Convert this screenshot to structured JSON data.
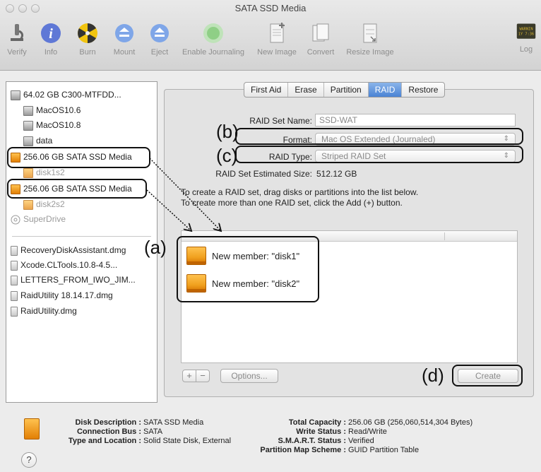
{
  "window": {
    "title": "SATA SSD Media"
  },
  "toolbar": {
    "items": [
      {
        "label": "Verify",
        "icon": "microscope-icon"
      },
      {
        "label": "Info",
        "icon": "info-icon"
      },
      {
        "label": "Burn",
        "icon": "burn-icon"
      },
      {
        "label": "Mount",
        "icon": "mount-icon"
      },
      {
        "label": "Eject",
        "icon": "eject-icon"
      },
      {
        "label": "Enable Journaling",
        "icon": "journal-icon"
      },
      {
        "label": "New Image",
        "icon": "new-image-icon"
      },
      {
        "label": "Convert",
        "icon": "convert-icon"
      },
      {
        "label": "Resize Image",
        "icon": "resize-image-icon"
      },
      {
        "label": "Log",
        "icon": "log-icon"
      }
    ],
    "log_icon_text": "WARNIN\n1Y 7:36"
  },
  "sidebar": {
    "items": [
      {
        "label": "64.02 GB C300-MTFDD...",
        "type": "disk-grey"
      },
      {
        "label": "MacOS10.6",
        "type": "disk-grey"
      },
      {
        "label": "MacOS10.8",
        "type": "disk-grey"
      },
      {
        "label": "data",
        "type": "disk-grey"
      },
      {
        "label": "256.06 GB SATA SSD Media",
        "type": "disk-orange"
      },
      {
        "label": "disk1s2",
        "type": "disk-orange"
      },
      {
        "label": "256.06 GB SATA SSD Media",
        "type": "disk-orange"
      },
      {
        "label": "disk2s2",
        "type": "disk-orange"
      },
      {
        "label": "SuperDrive",
        "type": "optical"
      },
      {
        "label": "RecoveryDiskAssistant.dmg",
        "type": "dmg"
      },
      {
        "label": "Xcode.CLTools.10.8-4.5...",
        "type": "dmg"
      },
      {
        "label": "LETTERS_FROM_IWO_JIM...",
        "type": "dmg"
      },
      {
        "label": "RaidUtility 18.14.17.dmg",
        "type": "dmg"
      },
      {
        "label": "RaidUtility.dmg",
        "type": "dmg"
      }
    ]
  },
  "tabs": [
    "First Aid",
    "Erase",
    "Partition",
    "RAID",
    "Restore"
  ],
  "active_tab": "RAID",
  "raid": {
    "set_name_label": "RAID Set Name:",
    "set_name_value": "SSD-WAT",
    "format_label": "Format:",
    "format_value": "Mac OS Extended (Journaled)",
    "type_label": "RAID Type:",
    "type_value": "Striped RAID Set",
    "size_label": "RAID Set Estimated Size:",
    "size_value": "512.12 GB",
    "info_line1": "To create a RAID set, drag disks or partitions into the list below.",
    "info_line2": "To create more than one RAID set, click the Add (+) button.",
    "members": [
      "New member: \"disk1\"",
      "New member: \"disk2\""
    ],
    "add_label": "+",
    "remove_label": "−",
    "options_label": "Options...",
    "create_label": "Create"
  },
  "annotations": {
    "a": "(a)",
    "b": "(b)",
    "c": "(c)",
    "d": "(d)"
  },
  "details": {
    "disk_description_key": "Disk Description :",
    "disk_description_val": "SATA SSD Media",
    "connection_bus_key": "Connection Bus :",
    "connection_bus_val": "SATA",
    "type_location_key": "Type and Location :",
    "type_location_val": "Solid State Disk, External",
    "total_capacity_key": "Total Capacity :",
    "total_capacity_val": "256.06 GB (256,060,514,304 Bytes)",
    "write_status_key": "Write Status :",
    "write_status_val": "Read/Write",
    "smart_status_key": "S.M.A.R.T. Status :",
    "smart_status_val": "Verified",
    "partition_scheme_key": "Partition Map Scheme :",
    "partition_scheme_val": "GUID Partition Table",
    "help_label": "?"
  }
}
